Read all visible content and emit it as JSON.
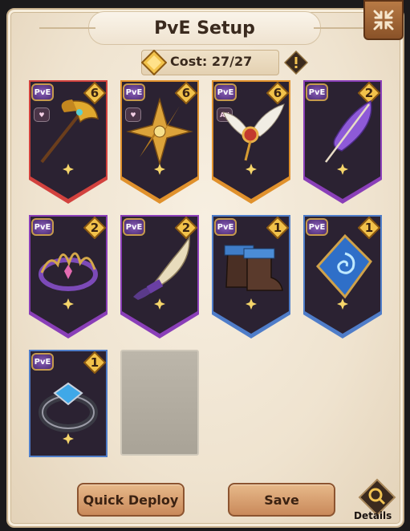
{
  "title": "PvE Setup",
  "cost": {
    "label": "Cost:",
    "value": "27/27"
  },
  "cards": [
    {
      "name": "golden-axe",
      "badge": "PvE",
      "cost": "6",
      "sub_badge": "heart",
      "rarity": "red"
    },
    {
      "name": "golden-shuriken",
      "badge": "PvE",
      "cost": "6",
      "sub_badge": "heart",
      "rarity": "orange"
    },
    {
      "name": "winged-emblem",
      "badge": "PvE",
      "cost": "6",
      "sub_badge": "All",
      "rarity": "orange"
    },
    {
      "name": "purple-feather",
      "badge": "PvE",
      "cost": "2",
      "sub_badge": "",
      "rarity": "purple"
    },
    {
      "name": "thorn-crown",
      "badge": "PvE",
      "cost": "2",
      "sub_badge": "",
      "rarity": "purple"
    },
    {
      "name": "curved-fang",
      "badge": "PvE",
      "cost": "2",
      "sub_badge": "",
      "rarity": "purple"
    },
    {
      "name": "leather-boots",
      "badge": "PvE",
      "cost": "1",
      "sub_badge": "",
      "rarity": "blue"
    },
    {
      "name": "spiral-talisman",
      "badge": "PvE",
      "cost": "1",
      "sub_badge": "",
      "rarity": "blue"
    },
    {
      "name": "blue-gem-ring",
      "badge": "PvE",
      "cost": "1",
      "sub_badge": "",
      "rarity": "blue"
    }
  ],
  "buttons": {
    "quick_deploy": "Quick Deploy",
    "save": "Save",
    "details": "Details"
  },
  "colors": {
    "red": "#d2423e",
    "orange": "#e0912c",
    "purple": "#8a3fb8",
    "blue": "#4f7dc9",
    "card_dark": "#2b2232"
  }
}
